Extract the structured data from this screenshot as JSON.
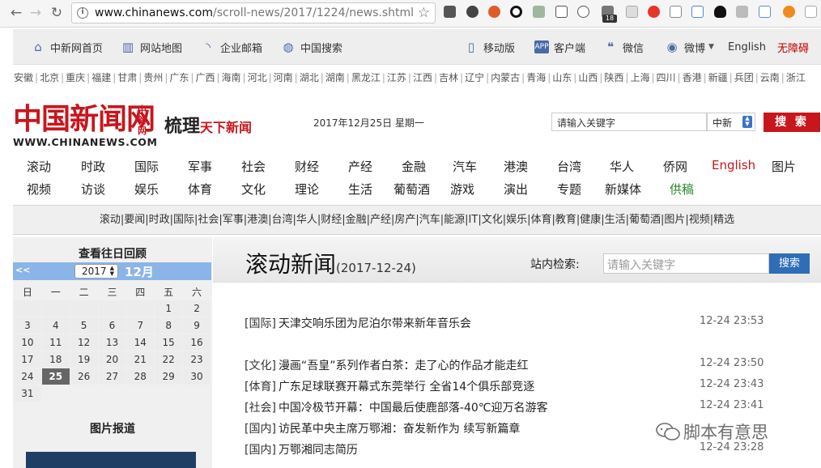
{
  "browser": {
    "url_host": "www.chinanews.com",
    "url_path": "/scroll-news/2017/1224/news.shtml",
    "ext_badge": "18"
  },
  "topbar": {
    "home": "中新网首页",
    "sitemap": "网站地图",
    "mail": "企业邮箱",
    "search": "中国搜索",
    "mobile": "移动版",
    "app": "客户端",
    "wechat": "微信",
    "weibo": "微博",
    "english": "English",
    "accessible": "无障碍"
  },
  "provinces": [
    "安徽",
    "北京",
    "重庆",
    "福建",
    "甘肃",
    "贵州",
    "广东",
    "广西",
    "海南",
    "河北",
    "河南",
    "湖北",
    "湖南",
    "黑龙江",
    "江苏",
    "江西",
    "吉林",
    "辽宁",
    "内蒙古",
    "青海",
    "山东",
    "山西",
    "陕西",
    "上海",
    "四川",
    "香港",
    "新疆",
    "兵团",
    "云南",
    "浙江"
  ],
  "header": {
    "logo_cn": "中国新闻网",
    "logo_side": "中新网",
    "logo_en": "WWW.CHINANEWS.COM",
    "slogan_a": "梳理",
    "slogan_b": "天下新闻",
    "date": "2017年12月25日 星期一",
    "search_placeholder": "请输入关键字",
    "search_select": "中新",
    "search_button": "搜 索"
  },
  "mainnav": {
    "row1": [
      "滚动",
      "时政",
      "国际",
      "军事",
      "社会",
      "财经",
      "产经",
      "金融",
      "汽车",
      "港澳",
      "台湾",
      "华人",
      "侨网",
      "English",
      "图片"
    ],
    "row2": [
      "视频",
      "访谈",
      "娱乐",
      "体育",
      "文化",
      "理论",
      "生活",
      "葡萄酒",
      "游戏",
      "演出",
      "专题",
      "新媒体",
      "供稿"
    ]
  },
  "subnav": "滚动|要闻|时政|国际|社会|军事|港澳|台湾|华人|财经|金融|产经|房产|汽车|能源|IT|文化|娱乐|体育|教育|健康|生活|葡萄酒|图片|视频|精选",
  "calendar": {
    "title": "查看往日回顾",
    "prev": "<<",
    "year": "2017",
    "month": "12月",
    "weekdays": [
      "日",
      "一",
      "二",
      "三",
      "四",
      "五",
      "六"
    ],
    "weeks": [
      [
        "",
        "",
        "",
        "",
        "",
        "1",
        "2"
      ],
      [
        "3",
        "4",
        "5",
        "6",
        "7",
        "8",
        "9"
      ],
      [
        "10",
        "11",
        "12",
        "13",
        "14",
        "15",
        "16"
      ],
      [
        "17",
        "18",
        "19",
        "20",
        "21",
        "22",
        "23"
      ],
      [
        "24",
        "25",
        "26",
        "27",
        "28",
        "29",
        "30"
      ],
      [
        "31",
        "",
        "",
        "",
        "",
        "",
        ""
      ]
    ],
    "selected": "25"
  },
  "pictures": {
    "title": "图片报道"
  },
  "news": {
    "title": "滚动新闻",
    "date": "(2017-12-24)",
    "site_search_label": "站内检索:",
    "site_search_placeholder": "请输入关键字",
    "site_search_button": "搜索",
    "items": [
      {
        "cat": "[国际]",
        "title": "天津交响乐团为尼泊尔带来新年音乐会",
        "time": "12-24 23:53"
      },
      {
        "cat": "[文化]",
        "title": "漫画“吾皇”系列作者白茶：走了心的作品才能走红",
        "time": "12-24 23:50"
      },
      {
        "cat": "[体育]",
        "title": "广东足球联赛开幕式东莞举行 全省14个俱乐部竞逐",
        "time": "12-24 23:43"
      },
      {
        "cat": "[社会]",
        "title": "中国冷极节开幕：中国最后使鹿部落-40℃迎万名游客",
        "time": "12-24 23:41"
      },
      {
        "cat": "[国内]",
        "title": "访民革中央主席万鄂湘：奋发新作为 续写新篇章",
        "time": ""
      },
      {
        "cat": "[国内]",
        "title": "万鄂湘同志简历",
        "time": "12-24 23:28"
      }
    ]
  },
  "watermark": "脚本有意思"
}
